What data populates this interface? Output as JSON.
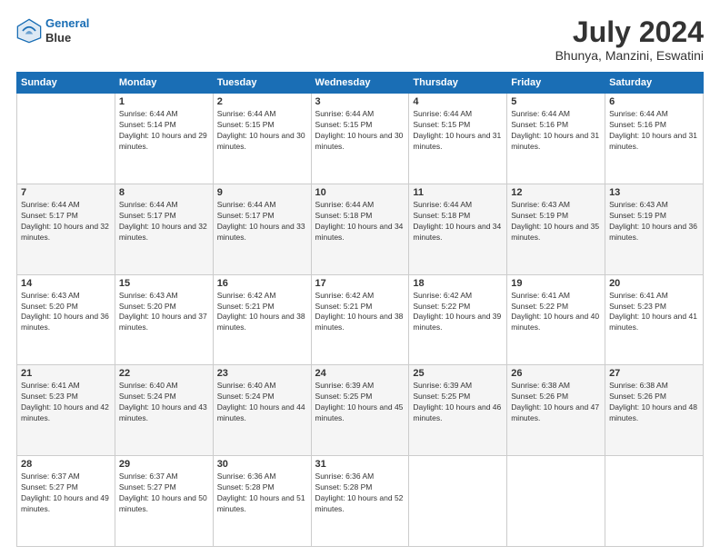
{
  "header": {
    "logo_line1": "General",
    "logo_line2": "Blue",
    "title": "July 2024",
    "subtitle": "Bhunya, Manzini, Eswatini"
  },
  "weekdays": [
    "Sunday",
    "Monday",
    "Tuesday",
    "Wednesday",
    "Thursday",
    "Friday",
    "Saturday"
  ],
  "weeks": [
    [
      {
        "day": "",
        "sunrise": "",
        "sunset": "",
        "daylight": ""
      },
      {
        "day": "1",
        "sunrise": "Sunrise: 6:44 AM",
        "sunset": "Sunset: 5:14 PM",
        "daylight": "Daylight: 10 hours and 29 minutes."
      },
      {
        "day": "2",
        "sunrise": "Sunrise: 6:44 AM",
        "sunset": "Sunset: 5:15 PM",
        "daylight": "Daylight: 10 hours and 30 minutes."
      },
      {
        "day": "3",
        "sunrise": "Sunrise: 6:44 AM",
        "sunset": "Sunset: 5:15 PM",
        "daylight": "Daylight: 10 hours and 30 minutes."
      },
      {
        "day": "4",
        "sunrise": "Sunrise: 6:44 AM",
        "sunset": "Sunset: 5:15 PM",
        "daylight": "Daylight: 10 hours and 31 minutes."
      },
      {
        "day": "5",
        "sunrise": "Sunrise: 6:44 AM",
        "sunset": "Sunset: 5:16 PM",
        "daylight": "Daylight: 10 hours and 31 minutes."
      },
      {
        "day": "6",
        "sunrise": "Sunrise: 6:44 AM",
        "sunset": "Sunset: 5:16 PM",
        "daylight": "Daylight: 10 hours and 31 minutes."
      }
    ],
    [
      {
        "day": "7",
        "sunrise": "Sunrise: 6:44 AM",
        "sunset": "Sunset: 5:17 PM",
        "daylight": "Daylight: 10 hours and 32 minutes."
      },
      {
        "day": "8",
        "sunrise": "Sunrise: 6:44 AM",
        "sunset": "Sunset: 5:17 PM",
        "daylight": "Daylight: 10 hours and 32 minutes."
      },
      {
        "day": "9",
        "sunrise": "Sunrise: 6:44 AM",
        "sunset": "Sunset: 5:17 PM",
        "daylight": "Daylight: 10 hours and 33 minutes."
      },
      {
        "day": "10",
        "sunrise": "Sunrise: 6:44 AM",
        "sunset": "Sunset: 5:18 PM",
        "daylight": "Daylight: 10 hours and 34 minutes."
      },
      {
        "day": "11",
        "sunrise": "Sunrise: 6:44 AM",
        "sunset": "Sunset: 5:18 PM",
        "daylight": "Daylight: 10 hours and 34 minutes."
      },
      {
        "day": "12",
        "sunrise": "Sunrise: 6:43 AM",
        "sunset": "Sunset: 5:19 PM",
        "daylight": "Daylight: 10 hours and 35 minutes."
      },
      {
        "day": "13",
        "sunrise": "Sunrise: 6:43 AM",
        "sunset": "Sunset: 5:19 PM",
        "daylight": "Daylight: 10 hours and 36 minutes."
      }
    ],
    [
      {
        "day": "14",
        "sunrise": "Sunrise: 6:43 AM",
        "sunset": "Sunset: 5:20 PM",
        "daylight": "Daylight: 10 hours and 36 minutes."
      },
      {
        "day": "15",
        "sunrise": "Sunrise: 6:43 AM",
        "sunset": "Sunset: 5:20 PM",
        "daylight": "Daylight: 10 hours and 37 minutes."
      },
      {
        "day": "16",
        "sunrise": "Sunrise: 6:42 AM",
        "sunset": "Sunset: 5:21 PM",
        "daylight": "Daylight: 10 hours and 38 minutes."
      },
      {
        "day": "17",
        "sunrise": "Sunrise: 6:42 AM",
        "sunset": "Sunset: 5:21 PM",
        "daylight": "Daylight: 10 hours and 38 minutes."
      },
      {
        "day": "18",
        "sunrise": "Sunrise: 6:42 AM",
        "sunset": "Sunset: 5:22 PM",
        "daylight": "Daylight: 10 hours and 39 minutes."
      },
      {
        "day": "19",
        "sunrise": "Sunrise: 6:41 AM",
        "sunset": "Sunset: 5:22 PM",
        "daylight": "Daylight: 10 hours and 40 minutes."
      },
      {
        "day": "20",
        "sunrise": "Sunrise: 6:41 AM",
        "sunset": "Sunset: 5:23 PM",
        "daylight": "Daylight: 10 hours and 41 minutes."
      }
    ],
    [
      {
        "day": "21",
        "sunrise": "Sunrise: 6:41 AM",
        "sunset": "Sunset: 5:23 PM",
        "daylight": "Daylight: 10 hours and 42 minutes."
      },
      {
        "day": "22",
        "sunrise": "Sunrise: 6:40 AM",
        "sunset": "Sunset: 5:24 PM",
        "daylight": "Daylight: 10 hours and 43 minutes."
      },
      {
        "day": "23",
        "sunrise": "Sunrise: 6:40 AM",
        "sunset": "Sunset: 5:24 PM",
        "daylight": "Daylight: 10 hours and 44 minutes."
      },
      {
        "day": "24",
        "sunrise": "Sunrise: 6:39 AM",
        "sunset": "Sunset: 5:25 PM",
        "daylight": "Daylight: 10 hours and 45 minutes."
      },
      {
        "day": "25",
        "sunrise": "Sunrise: 6:39 AM",
        "sunset": "Sunset: 5:25 PM",
        "daylight": "Daylight: 10 hours and 46 minutes."
      },
      {
        "day": "26",
        "sunrise": "Sunrise: 6:38 AM",
        "sunset": "Sunset: 5:26 PM",
        "daylight": "Daylight: 10 hours and 47 minutes."
      },
      {
        "day": "27",
        "sunrise": "Sunrise: 6:38 AM",
        "sunset": "Sunset: 5:26 PM",
        "daylight": "Daylight: 10 hours and 48 minutes."
      }
    ],
    [
      {
        "day": "28",
        "sunrise": "Sunrise: 6:37 AM",
        "sunset": "Sunset: 5:27 PM",
        "daylight": "Daylight: 10 hours and 49 minutes."
      },
      {
        "day": "29",
        "sunrise": "Sunrise: 6:37 AM",
        "sunset": "Sunset: 5:27 PM",
        "daylight": "Daylight: 10 hours and 50 minutes."
      },
      {
        "day": "30",
        "sunrise": "Sunrise: 6:36 AM",
        "sunset": "Sunset: 5:28 PM",
        "daylight": "Daylight: 10 hours and 51 minutes."
      },
      {
        "day": "31",
        "sunrise": "Sunrise: 6:36 AM",
        "sunset": "Sunset: 5:28 PM",
        "daylight": "Daylight: 10 hours and 52 minutes."
      },
      {
        "day": "",
        "sunrise": "",
        "sunset": "",
        "daylight": ""
      },
      {
        "day": "",
        "sunrise": "",
        "sunset": "",
        "daylight": ""
      },
      {
        "day": "",
        "sunrise": "",
        "sunset": "",
        "daylight": ""
      }
    ]
  ],
  "colors": {
    "header_bg": "#1a6eb5",
    "header_text": "#ffffff",
    "accent": "#1a6eb5"
  }
}
